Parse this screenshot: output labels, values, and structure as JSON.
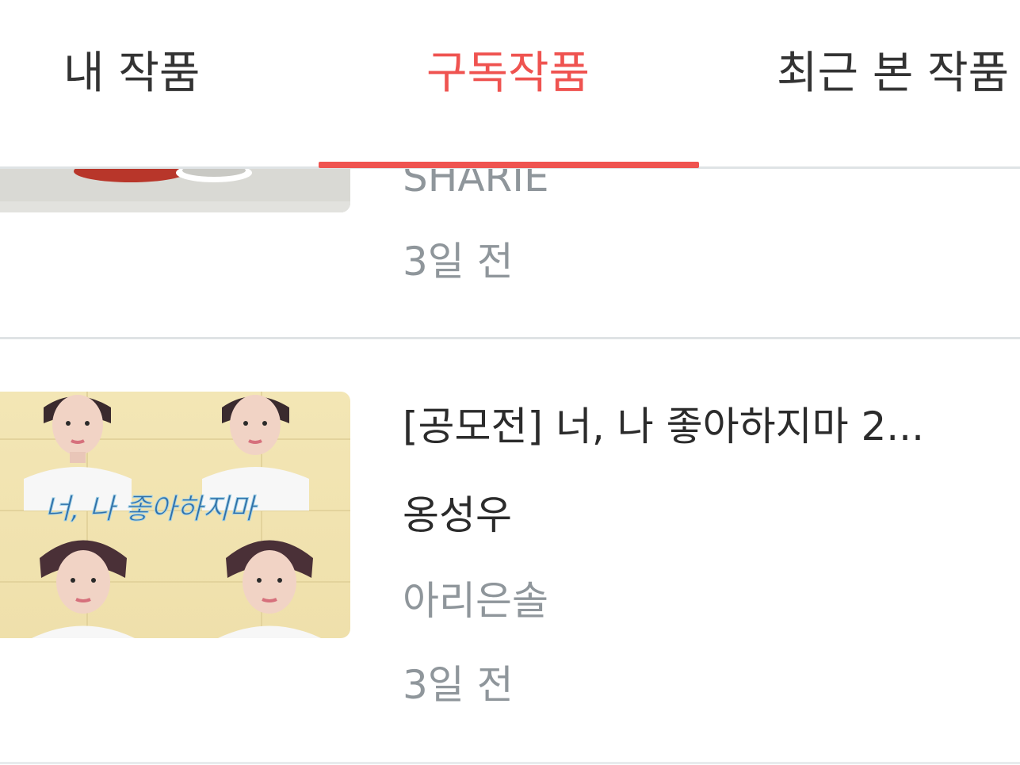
{
  "tabs": [
    {
      "label": "내 작품",
      "active": false
    },
    {
      "label": "구독작품",
      "active": true
    },
    {
      "label": "최근 본 작품",
      "active": false
    }
  ],
  "colors": {
    "accent": "#ef5350",
    "muted": "#8f969b",
    "text": "#2b2b2b",
    "divider": "#dfe3e5"
  },
  "items": [
    {
      "author": "SHARIE",
      "time": "3일 전"
    },
    {
      "title": "[공모전] 너, 나 좋아하지마 2...",
      "subtitle": "옹성우",
      "author": "아리은솔",
      "time": "3일 전",
      "cover_text": "너, 나 좋아하지마"
    }
  ]
}
